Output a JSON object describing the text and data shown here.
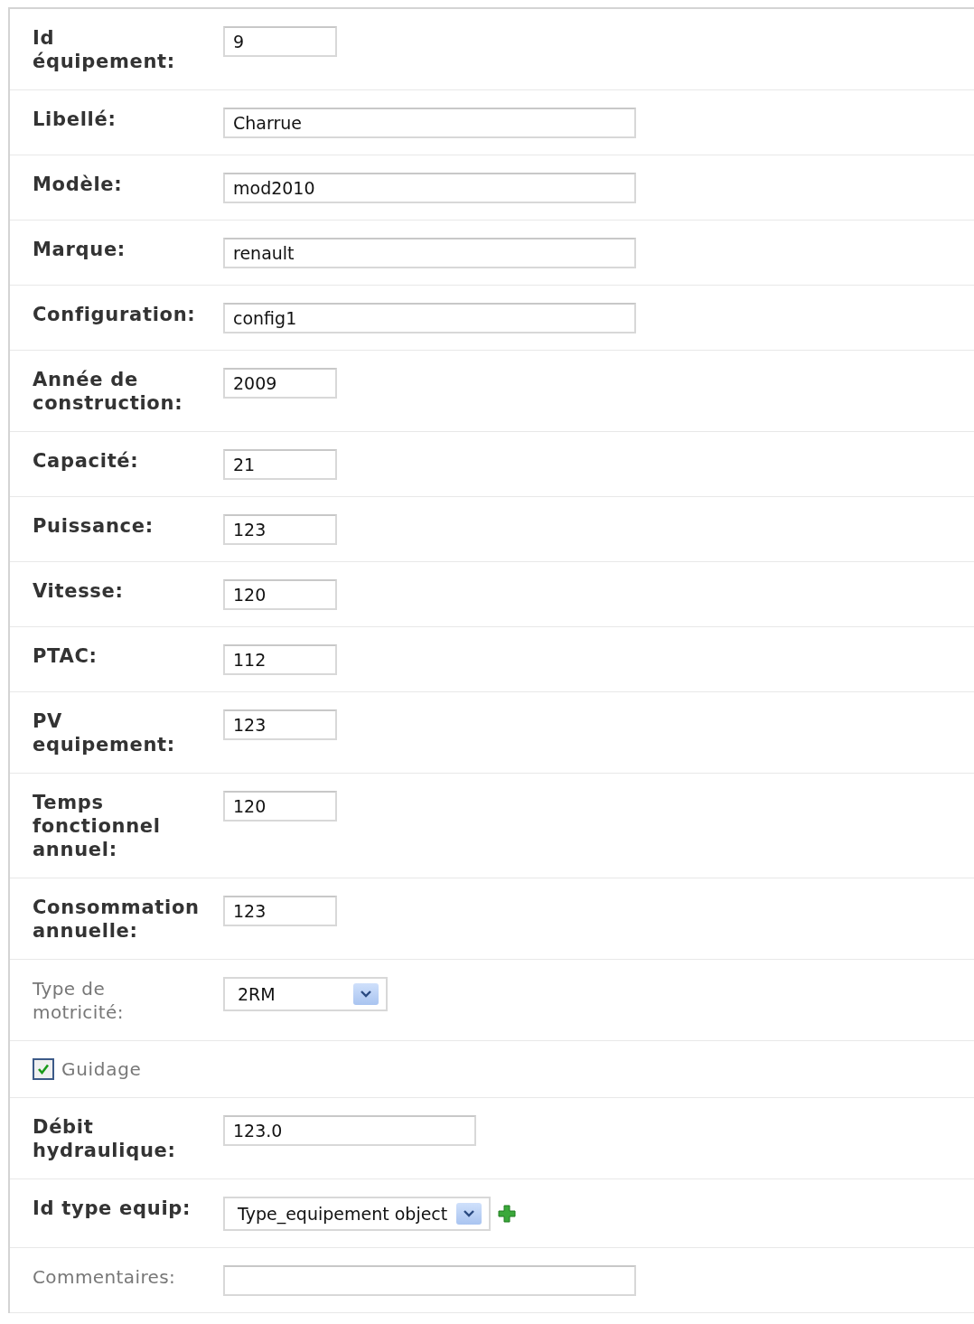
{
  "fields": [
    {
      "kind": "short-text",
      "label": "Id équipement:",
      "required": true,
      "value": "9"
    },
    {
      "kind": "long-text",
      "label": "Libellé:",
      "required": true,
      "value": "Charrue"
    },
    {
      "kind": "long-text",
      "label": "Modèle:",
      "required": true,
      "value": "mod2010"
    },
    {
      "kind": "long-text",
      "label": "Marque:",
      "required": true,
      "value": "renault"
    },
    {
      "kind": "long-text",
      "label": "Configuration:",
      "required": true,
      "value": "config1"
    },
    {
      "kind": "short-text",
      "label": "Année de construction:",
      "required": true,
      "value": "2009"
    },
    {
      "kind": "short-text",
      "label": "Capacité:",
      "required": true,
      "value": "21"
    },
    {
      "kind": "short-text",
      "label": "Puissance:",
      "required": true,
      "value": "123"
    },
    {
      "kind": "short-text",
      "label": "Vitesse:",
      "required": true,
      "value": "120"
    },
    {
      "kind": "short-text",
      "label": "PTAC:",
      "required": true,
      "value": "112"
    },
    {
      "kind": "short-text",
      "label": "PV equipement:",
      "required": true,
      "value": "123"
    },
    {
      "kind": "short-text",
      "label": "Temps fonctionnel annuel:",
      "required": true,
      "value": "120"
    },
    {
      "kind": "short-text",
      "label": "Consommation annuelle:",
      "required": true,
      "value": "123"
    },
    {
      "kind": "select",
      "label": "Type de motricité:",
      "required": false,
      "value": "2RM",
      "addable": false
    },
    {
      "kind": "checkbox",
      "label": "Guidage",
      "required": false,
      "checked": true
    },
    {
      "kind": "medium-text",
      "label": "Débit hydraulique:",
      "required": true,
      "value": "123.0"
    },
    {
      "kind": "select",
      "label": "Id type equip:",
      "required": true,
      "value": "Type_equipement object",
      "addable": true
    },
    {
      "kind": "long-text",
      "label": "Commentaires:",
      "required": false
    }
  ]
}
